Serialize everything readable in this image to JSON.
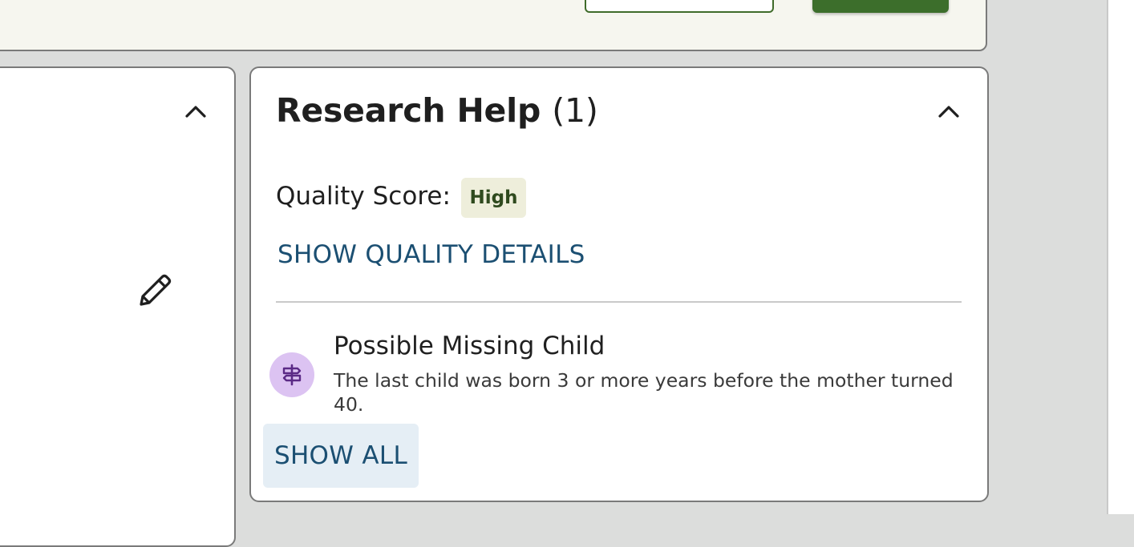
{
  "research_help": {
    "title": "Research Help",
    "count": "(1)",
    "quality_label": "Quality Score:",
    "quality_value": "High",
    "quality_details_link": "SHOW QUALITY DETAILS",
    "hints": [
      {
        "icon": "signpost-icon",
        "title": "Possible Missing Child",
        "description": "The last child was born 3 or more years before the mother turned 40."
      }
    ],
    "show_all_label": "SHOW ALL"
  },
  "icons": {
    "collapse": "chevron-up-icon",
    "edit": "pencil-icon"
  },
  "colors": {
    "primary_green": "#3c6e2b",
    "link_blue": "#1b4f72",
    "badge_bg": "#eeeedb",
    "hint_icon_bg": "#dcc3f2",
    "hint_icon_fg": "#5b2a86",
    "show_all_bg": "#e5eef5"
  }
}
